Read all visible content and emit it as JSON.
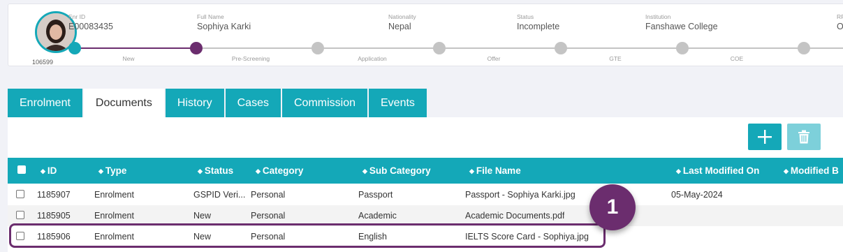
{
  "header": {
    "avatar_id": "106599",
    "fields": [
      {
        "label": "Enr ID",
        "value": "E00083435"
      },
      {
        "label": "Full Name",
        "value": "Sophiya Karki"
      },
      {
        "label": "Nationality",
        "value": "Nepal"
      },
      {
        "label": "Status",
        "value": "Incomplete"
      },
      {
        "label": "Institution",
        "value": "Fanshawe College"
      },
      {
        "label": "RP",
        "value": "Ol"
      }
    ],
    "stages": [
      "New",
      "Pre-Screening",
      "Application",
      "Offer",
      "GTE",
      "COE"
    ],
    "colors": {
      "active_dot": "#14a8b8",
      "done_dot": "#6b2d6e",
      "pending_dot": "#c4c4c4"
    }
  },
  "tabs": [
    "Enrolment",
    "Documents",
    "History",
    "Cases",
    "Commission",
    "Events"
  ],
  "active_tab": "Documents",
  "toolbar": {
    "add_icon": "plus-icon",
    "delete_icon": "trash-icon"
  },
  "table": {
    "columns": [
      "ID",
      "Type",
      "Status",
      "Category",
      "Sub Category",
      "File Name",
      "Last Modified On",
      "Modified B"
    ],
    "rows": [
      {
        "id": "1185907",
        "type": "Enrolment",
        "status": "GSPID Veri...",
        "category": "Personal",
        "sub_category": "Passport",
        "file_name": "Passport - Sophiya Karki.jpg",
        "last_modified": "05-May-2024"
      },
      {
        "id": "1185905",
        "type": "Enrolment",
        "status": "New",
        "category": "Personal",
        "sub_category": "Academic",
        "file_name": "Academic Documents.pdf",
        "last_modified": ""
      },
      {
        "id": "1185906",
        "type": "Enrolment",
        "status": "New",
        "category": "Personal",
        "sub_category": "English",
        "file_name": "IELTS Score Card - Sophiya.jpg",
        "last_modified": ""
      }
    ]
  },
  "callout": {
    "number": "1",
    "color": "#6b2d6e"
  },
  "accent_color": "#14a8b8"
}
